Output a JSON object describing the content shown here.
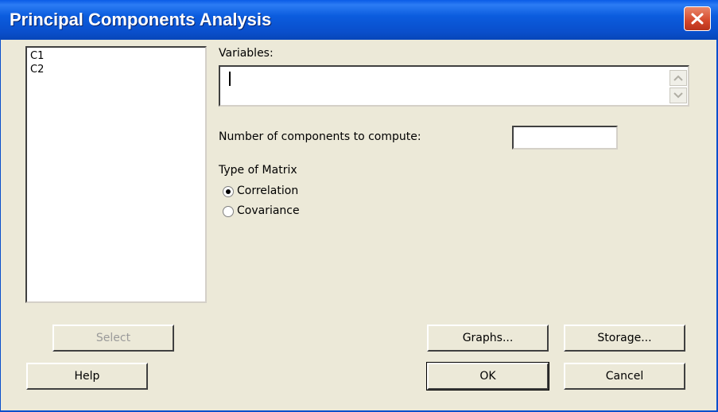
{
  "window": {
    "title": "Principal Components Analysis",
    "close_icon": "close-icon"
  },
  "column_list": {
    "items": [
      "C1",
      "C2"
    ]
  },
  "variables": {
    "label": "Variables:",
    "value": ""
  },
  "num_components": {
    "label": "Number of components to compute:",
    "value": ""
  },
  "matrix_type": {
    "heading": "Type of Matrix",
    "options": [
      {
        "label": "Correlation",
        "selected": true
      },
      {
        "label": "Covariance",
        "selected": false
      }
    ]
  },
  "buttons": {
    "select": "Select",
    "help": "Help",
    "graphs": "Graphs...",
    "storage": "Storage...",
    "ok": "OK",
    "cancel": "Cancel"
  },
  "colors": {
    "titlebar": "#0A4FCC",
    "dialog_bg": "#ECE9D8",
    "close_button": "#D4472A"
  }
}
